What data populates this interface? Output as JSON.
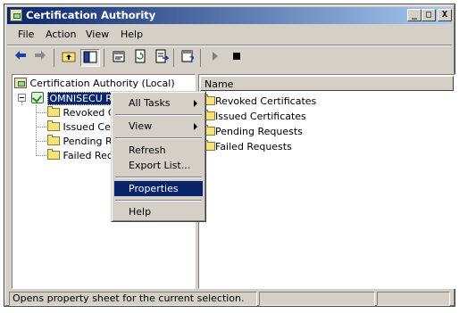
{
  "window": {
    "title": "Certification Authority"
  },
  "title_buttons": {
    "minimize": "_",
    "maximize": "□",
    "close": "X"
  },
  "menu": [
    "File",
    "Action",
    "View",
    "Help"
  ],
  "toolbar": [
    "back-arrow-icon",
    "forward-arrow-icon",
    "up-folder-icon",
    "show-hide-tree-icon",
    "properties-icon",
    "refresh-icon",
    "export-list-icon",
    "help-icon",
    "start-service-icon",
    "stop-service-icon"
  ],
  "tree": {
    "root": "Certification Authority (Local)",
    "ca": "OMNISECU ROOT CA",
    "children": [
      "Revoked Ce",
      "Issued Cert",
      "Pending Rec",
      "Failed Requ"
    ]
  },
  "list": {
    "header": "Name",
    "items": [
      "Revoked Certificates",
      "Issued Certificates",
      "Pending Requests",
      "Failed Requests"
    ]
  },
  "context_menu": {
    "items": [
      "All Tasks",
      "View",
      "Refresh",
      "Export List...",
      "Properties",
      "Help"
    ],
    "selected": "Properties"
  },
  "status": {
    "text": "Opens property sheet for the current selection."
  },
  "colors": {
    "title_start": "#0a246a",
    "title_end": "#a6caf0",
    "selection": "#0a246a",
    "face": "#d4d0c8"
  }
}
